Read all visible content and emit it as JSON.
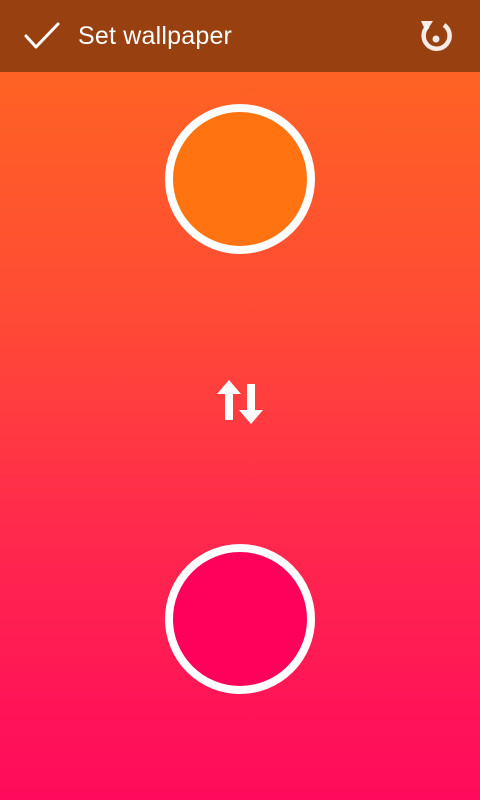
{
  "toolbar": {
    "title": "Set wallpaper",
    "confirm_icon": "check-icon",
    "reset_icon": "reset-icon",
    "background_color": "#994010"
  },
  "gradient": {
    "start_color": "#ff6a1f",
    "end_color": "#ff0a5c"
  },
  "swatches": {
    "top_color": "#ff7410",
    "bottom_color": "#ff005a"
  },
  "swap": {
    "icon": "swap-vertical-icon"
  }
}
